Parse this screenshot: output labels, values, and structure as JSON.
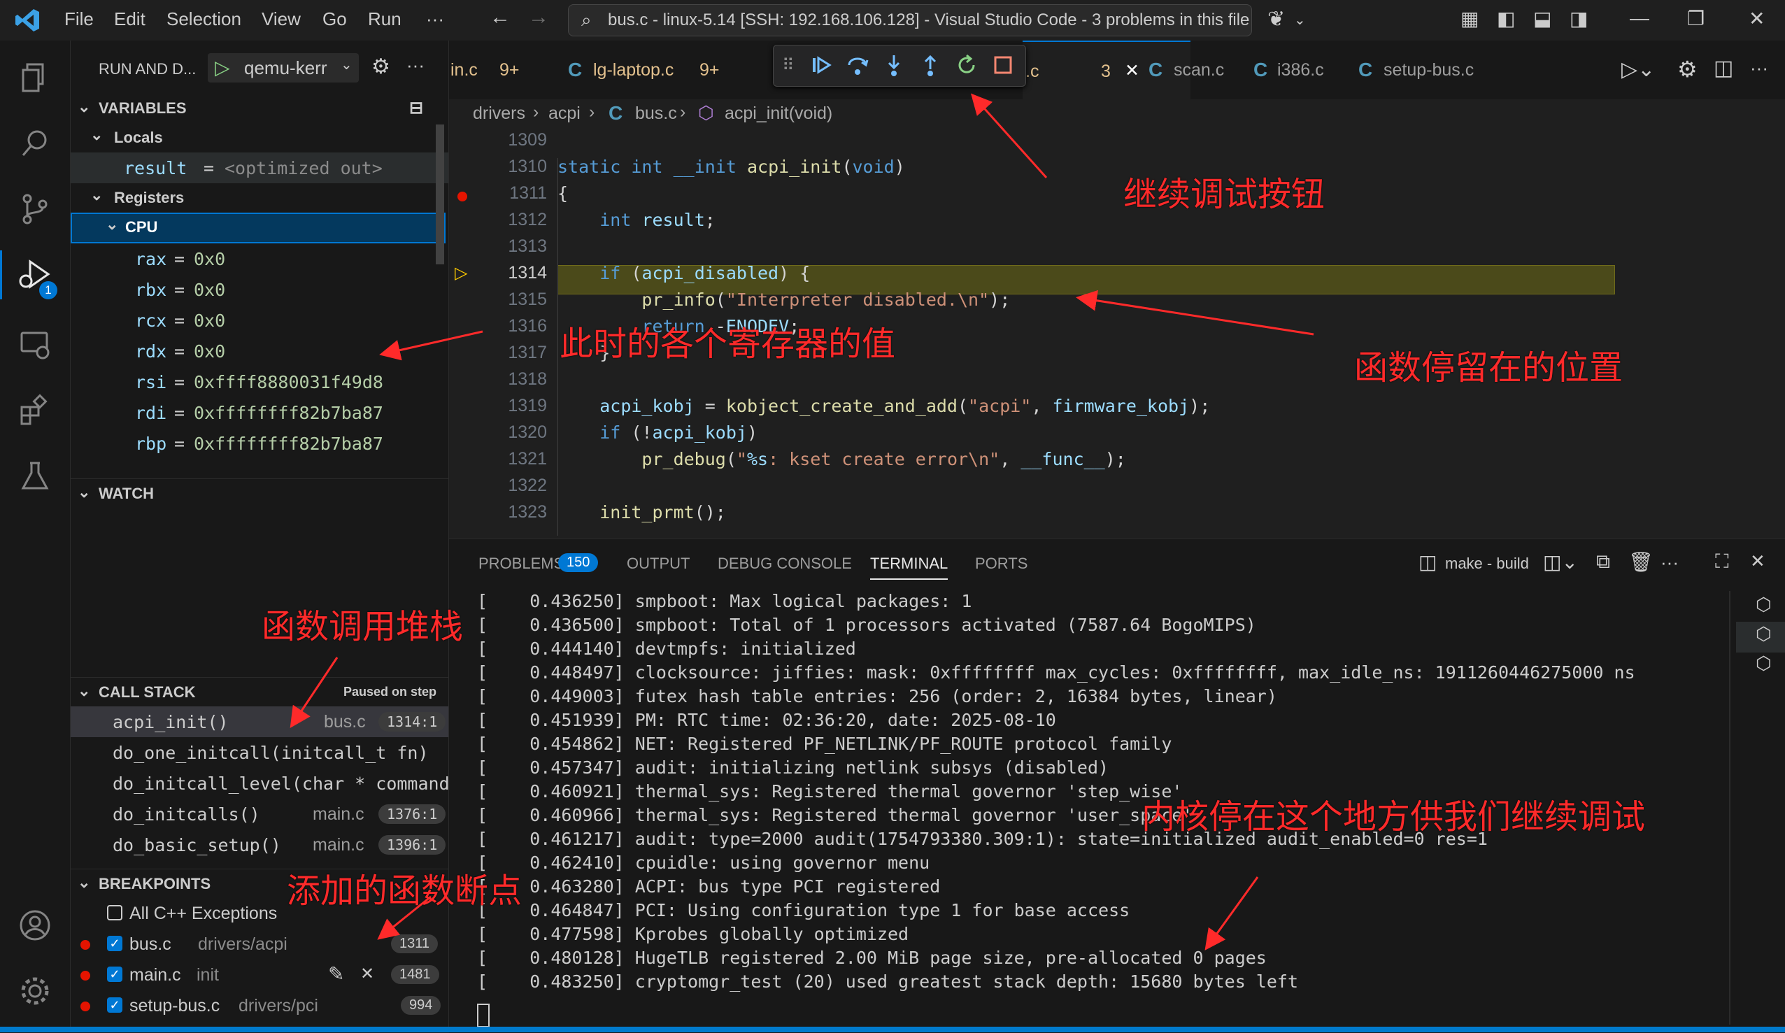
{
  "titlebar": {
    "menus": [
      "File",
      "Edit",
      "Selection",
      "View",
      "Go",
      "Run",
      "···"
    ],
    "command_center": "bus.c - linux-5.14 [SSH: 192.168.106.128] - Visual Studio Code - 3 problems in this file"
  },
  "activity": {
    "debug_badge": "1"
  },
  "sidebar": {
    "title": "RUN AND D...",
    "config": "qemu-kerr",
    "variables_header": "VARIABLES",
    "locals_label": "Locals",
    "locals": [
      {
        "name": "result",
        "value": "<optimized out>"
      }
    ],
    "registers_label": "Registers",
    "cpu_label": "CPU",
    "registers": [
      {
        "name": "rax",
        "value": "0x0"
      },
      {
        "name": "rbx",
        "value": "0x0"
      },
      {
        "name": "rcx",
        "value": "0x0"
      },
      {
        "name": "rdx",
        "value": "0x0"
      },
      {
        "name": "rsi",
        "value": "0xffff8880031f49d8"
      },
      {
        "name": "rdi",
        "value": "0xffffffff82b7ba87"
      },
      {
        "name": "rbp",
        "value": "0xffffffff82b7ba87"
      }
    ],
    "watch_header": "WATCH",
    "callstack_header": "CALL STACK",
    "callstack_status": "Paused on step",
    "frames": [
      {
        "fn": "acpi_init()",
        "file": "bus.c",
        "pos": "1314:1"
      },
      {
        "fn": "do_one_initcall(initcall_t fn)",
        "file": "",
        "pos": ""
      },
      {
        "fn": "do_initcall_level(char * command_l",
        "file": "",
        "pos": ""
      },
      {
        "fn": "do_initcalls()",
        "file": "main.c",
        "pos": "1376:1"
      },
      {
        "fn": "do_basic_setup()",
        "file": "main.c",
        "pos": "1396:1"
      }
    ],
    "breakpoints_header": "BREAKPOINTS",
    "breakpoints": [
      {
        "label": "All C++ Exceptions",
        "path": "",
        "line": ""
      },
      {
        "label": "bus.c",
        "path": "drivers/acpi",
        "line": "1311"
      },
      {
        "label": "main.c",
        "path": "init",
        "line": "1481"
      },
      {
        "label": "setup-bus.c",
        "path": "drivers/pci",
        "line": "994"
      }
    ]
  },
  "tabs": [
    {
      "label": "in.c",
      "badge": "9+"
    },
    {
      "label": "lg-laptop.c",
      "badge": "9+"
    },
    {
      "label": ".c",
      "badge": "3"
    },
    {
      "label": "scan.c",
      "badge": ""
    },
    {
      "label": "i386.c",
      "badge": ""
    },
    {
      "label": "setup-bus.c",
      "badge": ""
    }
  ],
  "breadcrumb": {
    "parts": [
      "drivers",
      "acpi",
      "bus.c",
      "acpi_init(void)"
    ]
  },
  "editor": {
    "line_numbers": [
      "1309",
      "1310",
      "1311",
      "1312",
      "1313",
      "1314",
      "1315",
      "1316",
      "1317",
      "1318",
      "1319",
      "1320",
      "1321",
      "1322",
      "1323"
    ],
    "current_line": "1314",
    "breakpoint_line": "1311"
  },
  "panel": {
    "tabs": [
      "PROBLEMS",
      "OUTPUT",
      "DEBUG CONSOLE",
      "TERMINAL",
      "PORTS"
    ],
    "problems_count": "150",
    "terminal_task": "make - build",
    "terminal_lines": [
      "[    0.436250] smpboot: Max logical packages: 1",
      "[    0.436500] smpboot: Total of 1 processors activated (7587.64 BogoMIPS)",
      "[    0.444140] devtmpfs: initialized",
      "[    0.448497] clocksource: jiffies: mask: 0xffffffff max_cycles: 0xffffffff, max_idle_ns: 1911260446275000 ns",
      "[    0.449003] futex hash table entries: 256 (order: 2, 16384 bytes, linear)",
      "[    0.451939] PM: RTC time: 02:36:20, date: 2025-08-10",
      "[    0.454862] NET: Registered PF_NETLINK/PF_ROUTE protocol family",
      "[    0.457347] audit: initializing netlink subsys (disabled)",
      "[    0.460921] thermal_sys: Registered thermal governor 'step_wise'",
      "[    0.460966] thermal_sys: Registered thermal governor 'user_space'",
      "[    0.461217] audit: type=2000 audit(1754793380.309:1): state=initialized audit_enabled=0 res=1",
      "[    0.462410] cpuidle: using governor menu",
      "[    0.463280] ACPI: bus type PCI registered",
      "[    0.464847] PCI: Using configuration type 1 for base access",
      "[    0.477598] Kprobes globally optimized",
      "[    0.480128] HugeTLB registered 2.00 MiB page size, pre-allocated 0 pages",
      "[    0.483250] cryptomgr_test (20) used greatest stack depth: 15680 bytes left"
    ]
  },
  "annotations": {
    "continue_button": "继续调试按钮",
    "register_values": "此时的各个寄存器的值",
    "stop_position": "函数停留在的位置",
    "call_stack": "函数调用堆栈",
    "kernel_paused": "内核停在这个地方供我们继续调试",
    "breakpoints_added": "添加的函数断点"
  },
  "colors": {
    "accent": "#007acc",
    "annotation": "#ff2a2a",
    "breakpoint": "#e51400",
    "current_line": "#4b4a1a"
  }
}
